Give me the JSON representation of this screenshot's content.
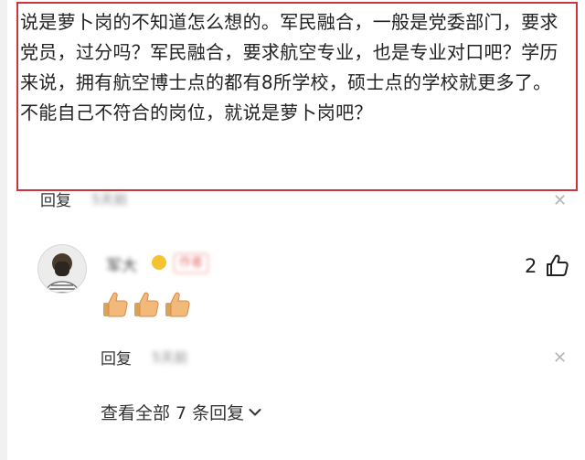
{
  "parent_comment": {
    "text": "说是萝卜岗的不知道怎么想的。军民融合，一般是党委部门，要求党员，过分吗？军民融合，要求航空专业，也是专业对口吧？学历来说，拥有航空博士点的都有8所学校，硕士点的学校就更多了。不能自己不符合的岗位，就说是萝卜岗吧？",
    "reply_label": "回复",
    "blurred_meta": "5天前",
    "close_icon": "close-icon"
  },
  "sub_comment": {
    "username": "军大",
    "tag": "作者",
    "like_count": "2",
    "like_icon": "thumbs-up-icon",
    "emoji_icon": "thumbs-up-emoji",
    "reply_label": "回复",
    "blurred_meta": "5天前",
    "close_icon": "close-icon"
  },
  "view_all": {
    "label": "查看全部 7 条回复",
    "icon": "chevron-down-icon"
  },
  "colors": {
    "highlight_border": "#d1333a",
    "badge_dot": "#f3c331",
    "tag_border": "#f08a8a"
  }
}
